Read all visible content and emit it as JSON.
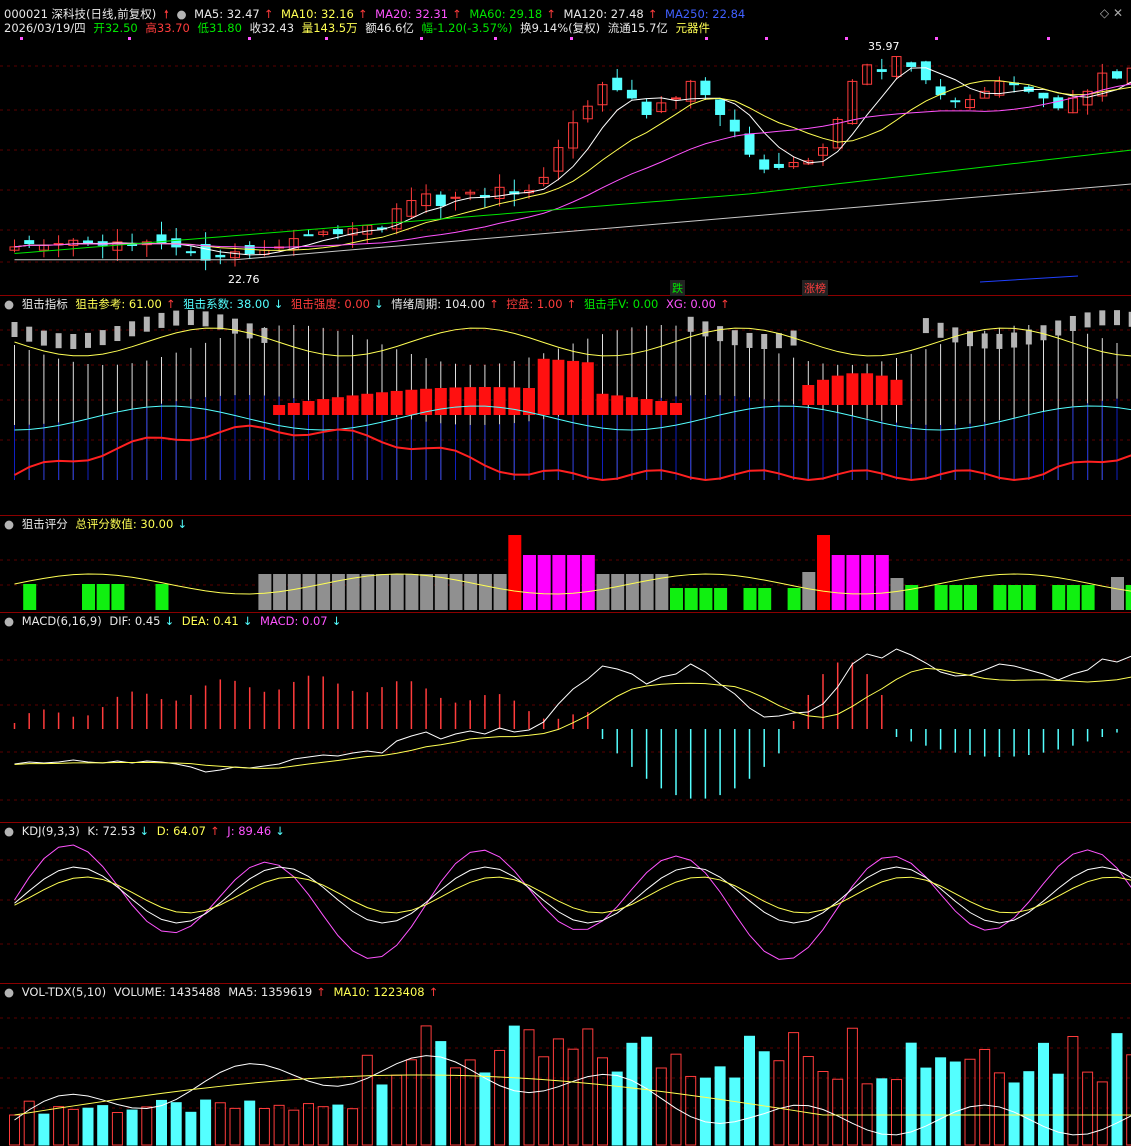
{
  "header": {
    "code_name": "000021 深科技(日线,前复权)",
    "ma5": "MA5: 32.47",
    "ma10": "MA10: 32.16",
    "ma20": "MA20: 32.31",
    "ma60": "MA60: 29.18",
    "ma120": "MA120: 27.48",
    "ma250": "MA250: 22.84",
    "date": "2026/03/19/四",
    "open": "开32.50",
    "high": "高33.70",
    "low": "低31.80",
    "close": "收32.43",
    "vol": "量143.5万",
    "amount": "额46.6亿",
    "change": "幅-1.20(-3.57%)",
    "turnover": "换9.14%(复权)",
    "float": "流通15.7亿",
    "sector": "元器件",
    "max_label": "35.97",
    "min_label": "22.76",
    "tag_die": "跌",
    "tag_zt": "涨榜"
  },
  "panel_sniper": {
    "title": "狙击指标",
    "ref": "狙击参考: 61.00",
    "coef": "狙击系数: 38.00",
    "strength": "狙击强度: 0.00",
    "cycle": "情绪周期: 104.00",
    "ctrl": "控盘: 1.00",
    "hand": "狙击手V: 0.00",
    "xg": "XG: 0.00"
  },
  "panel_score": {
    "title": "狙击评分",
    "total": "总评分数值: 30.00"
  },
  "panel_macd": {
    "title": "MACD(6,16,9)",
    "dif": "DIF: 0.45",
    "dea": "DEA: 0.41",
    "macd": "MACD: 0.07"
  },
  "panel_kdj": {
    "title": "KDJ(9,3,3)",
    "k": "K: 72.53",
    "d": "D: 64.07",
    "j": "J: 89.46"
  },
  "panel_vol": {
    "title": "VOL-TDX(5,10)",
    "volume": "VOLUME: 1435488",
    "ma5": "MA5: 1359619",
    "ma10": "MA10: 1223408"
  },
  "colors": {
    "up": "#ff3c3c",
    "down": "#54ffff",
    "ma5": "#ffffff",
    "ma10": "#ffff54",
    "ma20": "#ff54ff",
    "ma60": "#00e600",
    "ma120": "#c8c8c8",
    "ma250": "#2040ff"
  },
  "chart_data": {
    "type": "candlestick",
    "price_close": [
      24.0,
      24.2,
      24.1,
      24.2,
      24.4,
      24.2,
      24.1,
      24.3,
      24.1,
      24.3,
      24.2,
      24.0,
      23.7,
      23.2,
      23.4,
      23.7,
      23.6,
      23.8,
      24.0,
      24.5,
      24.7,
      24.9,
      24.8,
      25.1,
      25.3,
      25.1,
      26.3,
      26.8,
      27.2,
      26.5,
      27.0,
      27.3,
      27.0,
      27.6,
      27.2,
      27.4,
      28.2,
      30.0,
      31.5,
      32.5,
      33.8,
      33.5,
      33.0,
      32.0,
      32.7,
      33.0,
      34.0,
      33.2,
      32.0,
      31.0,
      29.6,
      28.7,
      28.8,
      29.1,
      29.2,
      30.0,
      31.7,
      34.0,
      35.0,
      34.6,
      35.5,
      34.9,
      34.1,
      33.2,
      32.8,
      32.9,
      33.4,
      34.0,
      33.8,
      33.4,
      33.0,
      32.4,
      33.0,
      33.4,
      34.5,
      34.2,
      34.8
    ],
    "macd_dif": [
      0.45
    ],
    "macd_dea": [
      0.41
    ],
    "macd": [
      0.07
    ],
    "kdj_k": [
      72.53
    ],
    "kdj_d": [
      64.07
    ],
    "kdj_j": [
      89.46
    ],
    "volume": [
      1435488
    ],
    "vol_ma5": [
      1359619
    ],
    "vol_ma10": [
      1223408
    ]
  }
}
